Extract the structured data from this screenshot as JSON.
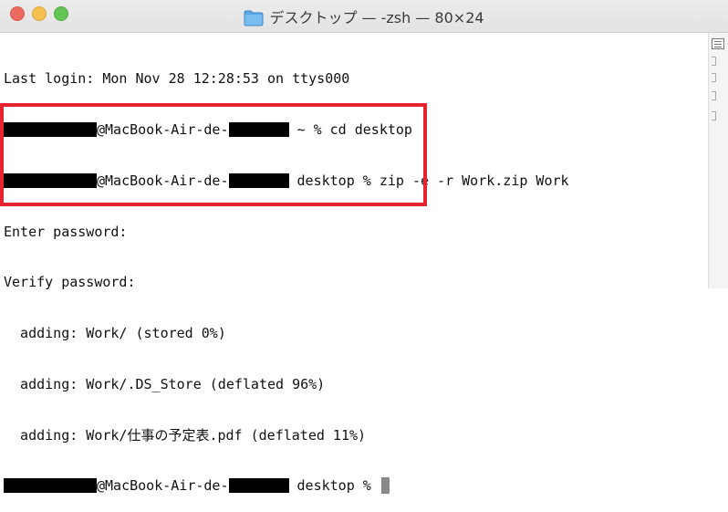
{
  "window": {
    "title": "デスクトップ — -zsh — 80×24",
    "folder_icon": "folder-icon",
    "traffic_lights": {
      "close": "#ed6a5e",
      "minimize": "#f5bf4f",
      "maximize": "#62c554"
    }
  },
  "terminal": {
    "last_login": "Last login: Mon Nov 28 12:28:53 on ttys000",
    "line2_host": "@MacBook-Air-de-",
    "line2_cmd": " ~ % cd desktop",
    "line3_host": "@MacBook-Air-de-",
    "line3_cmd": " desktop % zip -e -r Work.zip Work",
    "enter_password": "Enter password:",
    "verify_password": "Verify password:",
    "adding1": "  adding: Work/ (stored 0%)",
    "adding2": "  adding: Work/.DS_Store (deflated 96%)",
    "adding3": "  adding: Work/仕事の予定表.pdf (deflated 11%)",
    "prompt_host": "@MacBook-Air-de-",
    "prompt_cmd": " desktop % "
  },
  "annotation": {
    "highlight_color": "#e6232f"
  }
}
